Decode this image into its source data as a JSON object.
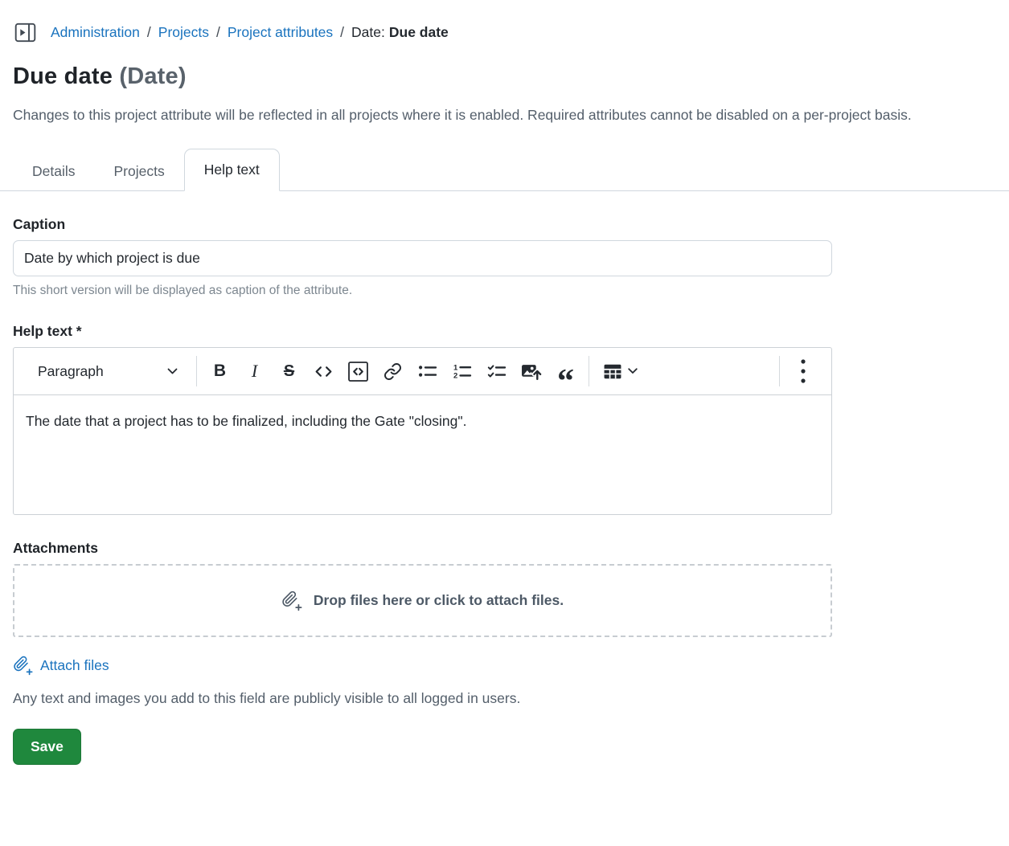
{
  "breadcrumb": {
    "links": [
      "Administration",
      "Projects",
      "Project attributes"
    ],
    "separator": "/",
    "current_prefix": "Date:",
    "current": "Due date"
  },
  "header": {
    "title": "Due date",
    "type_suffix": "(Date)",
    "description": "Changes to this project attribute will be reflected in all projects where it is enabled. Required attributes cannot be disabled on a per-project basis."
  },
  "tabs": [
    {
      "label": "Details",
      "active": false
    },
    {
      "label": "Projects",
      "active": false
    },
    {
      "label": "Help text",
      "active": true
    }
  ],
  "form": {
    "caption": {
      "label": "Caption",
      "value": "Date by which project is due",
      "hint": "This short version will be displayed as caption of the attribute."
    },
    "help_text": {
      "label": "Help text *",
      "content": "The date that a project has to be finalized, including the Gate \"closing\".",
      "toolbar": {
        "paragraph_label": "Paragraph",
        "bold_glyph": "B",
        "italic_glyph": "I",
        "strikethrough_glyph": "S",
        "quote_glyph": "“",
        "buttons": [
          "paragraph-style",
          "bold",
          "italic",
          "strikethrough",
          "inline-code",
          "code-block",
          "link",
          "bulleted-list",
          "numbered-list",
          "to-do-list",
          "insert-image",
          "block-quote",
          "insert-table",
          "show-more"
        ]
      }
    },
    "attachments": {
      "label": "Attachments",
      "dropzone_text": "Drop files here or click to attach files.",
      "attach_link": "Attach files",
      "visibility_note": "Any text and images you add to this field are publicly visible to all logged in users."
    },
    "save_label": "Save"
  },
  "colors": {
    "link": "#1a73be",
    "save_button": "#1f883d",
    "border": "#d0d7de",
    "muted_text": "#57606a"
  }
}
